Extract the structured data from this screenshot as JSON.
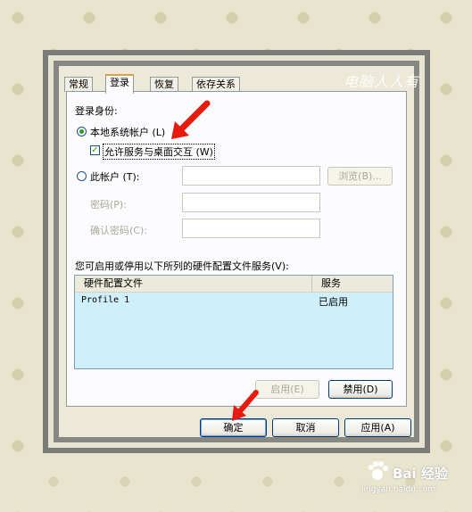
{
  "watermark": "电脑人人有",
  "tabs": [
    {
      "label": "常规"
    },
    {
      "label": "登录",
      "active": true
    },
    {
      "label": "恢复"
    },
    {
      "label": "依存关系"
    }
  ],
  "logon": {
    "group_label": "登录身份:",
    "local_system": {
      "label": "本地系统帐户 (L)",
      "selected": true
    },
    "interact_desktop": {
      "label": "允许服务与桌面交互 (W)",
      "checked": true
    },
    "this_account": {
      "label": "此帐户 (T):",
      "selected": false
    },
    "browse_button": "浏览(B)...",
    "password_label": "密码(P):",
    "confirm_password_label": "确认密码(C):"
  },
  "profiles": {
    "description": "您可启用或停用以下所列的硬件配置文件服务(V):",
    "columns": [
      "硬件配置文件",
      "服务"
    ],
    "rows": [
      {
        "profile": "Profile 1",
        "service": "已启用"
      }
    ],
    "enable_button": "启用(E)",
    "disable_button": "禁用(D)"
  },
  "footer": {
    "ok": "确定",
    "cancel": "取消",
    "apply": "应用(A)"
  },
  "branding": {
    "logo": "Bai 经验",
    "url": "jingyan.baidu.com"
  },
  "colors": {
    "arrow": "#e8190f",
    "list_bg": "#cff0fa",
    "tab_highlight": "#e69d3a"
  }
}
